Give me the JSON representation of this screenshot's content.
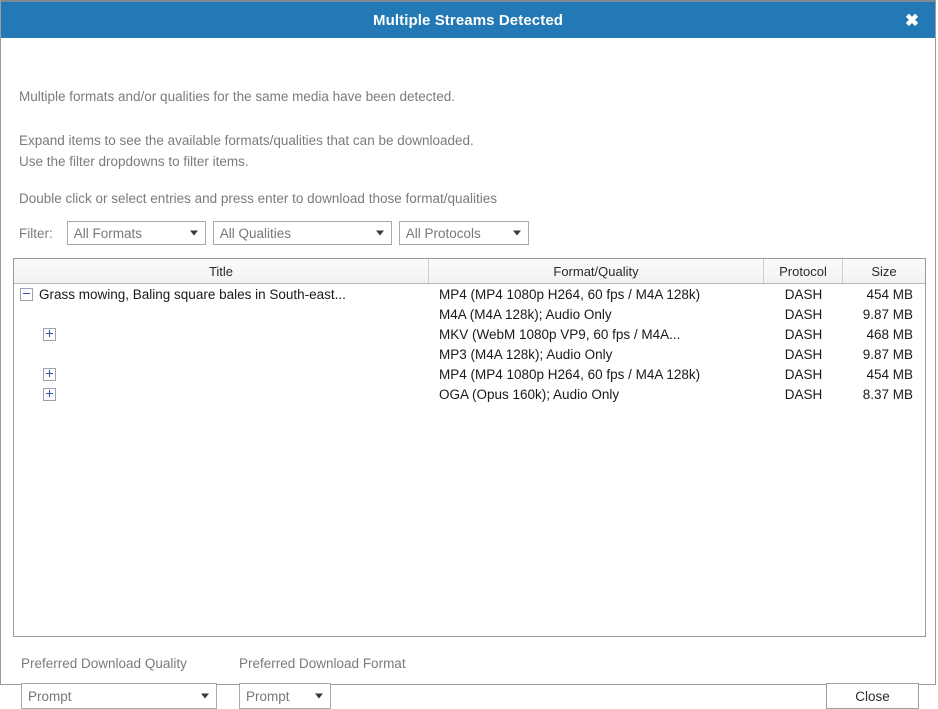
{
  "window": {
    "title": "Multiple Streams Detected",
    "close_icon": "close-x-icon",
    "titlebar_color": "#2279b5"
  },
  "intro": {
    "line1": "Multiple formats and/or qualities for the same media have been detected.",
    "line2": "Expand items to see the available formats/qualities that can be downloaded.",
    "line3": "Use the filter dropdowns to filter items.",
    "line4": "Double click or select entries and press enter to download those format/qualities"
  },
  "filter": {
    "label": "Filter:",
    "formats": {
      "value": "All Formats"
    },
    "qualities": {
      "value": "All Qualities"
    },
    "protocols": {
      "value": "All Protocols"
    }
  },
  "table": {
    "columns": [
      "Title",
      "Format/Quality",
      "Protocol",
      "Size"
    ],
    "rows": [
      {
        "twisty": "minus",
        "indented": false,
        "title": "Grass mowing, Baling square bales in South-east...",
        "format": "MP4 (MP4 1080p H264, 60 fps / M4A 128k)",
        "protocol": "DASH",
        "size": "454 MB"
      },
      {
        "twisty": "none",
        "indented": true,
        "title": "",
        "format": "M4A (M4A 128k); Audio Only",
        "protocol": "DASH",
        "size": "9.87 MB"
      },
      {
        "twisty": "plus",
        "indented": true,
        "title": "",
        "format": "MKV (WebM 1080p VP9, 60 fps / M4A...",
        "protocol": "DASH",
        "size": "468 MB"
      },
      {
        "twisty": "none",
        "indented": true,
        "title": "",
        "format": "MP3 (M4A 128k); Audio Only",
        "protocol": "DASH",
        "size": "9.87 MB"
      },
      {
        "twisty": "plus",
        "indented": true,
        "title": "",
        "format": "MP4 (MP4 1080p H264, 60 fps / M4A 128k)",
        "protocol": "DASH",
        "size": "454 MB"
      },
      {
        "twisty": "plus",
        "indented": true,
        "title": "",
        "format": "OGA (Opus 160k); Audio Only",
        "protocol": "DASH",
        "size": "8.37 MB"
      }
    ]
  },
  "footer": {
    "pref_quality_label": "Preferred Download Quality",
    "pref_quality_value": "Prompt",
    "pref_format_label": "Preferred Download Format",
    "pref_format_value": "Prompt",
    "close_button": "Close"
  }
}
